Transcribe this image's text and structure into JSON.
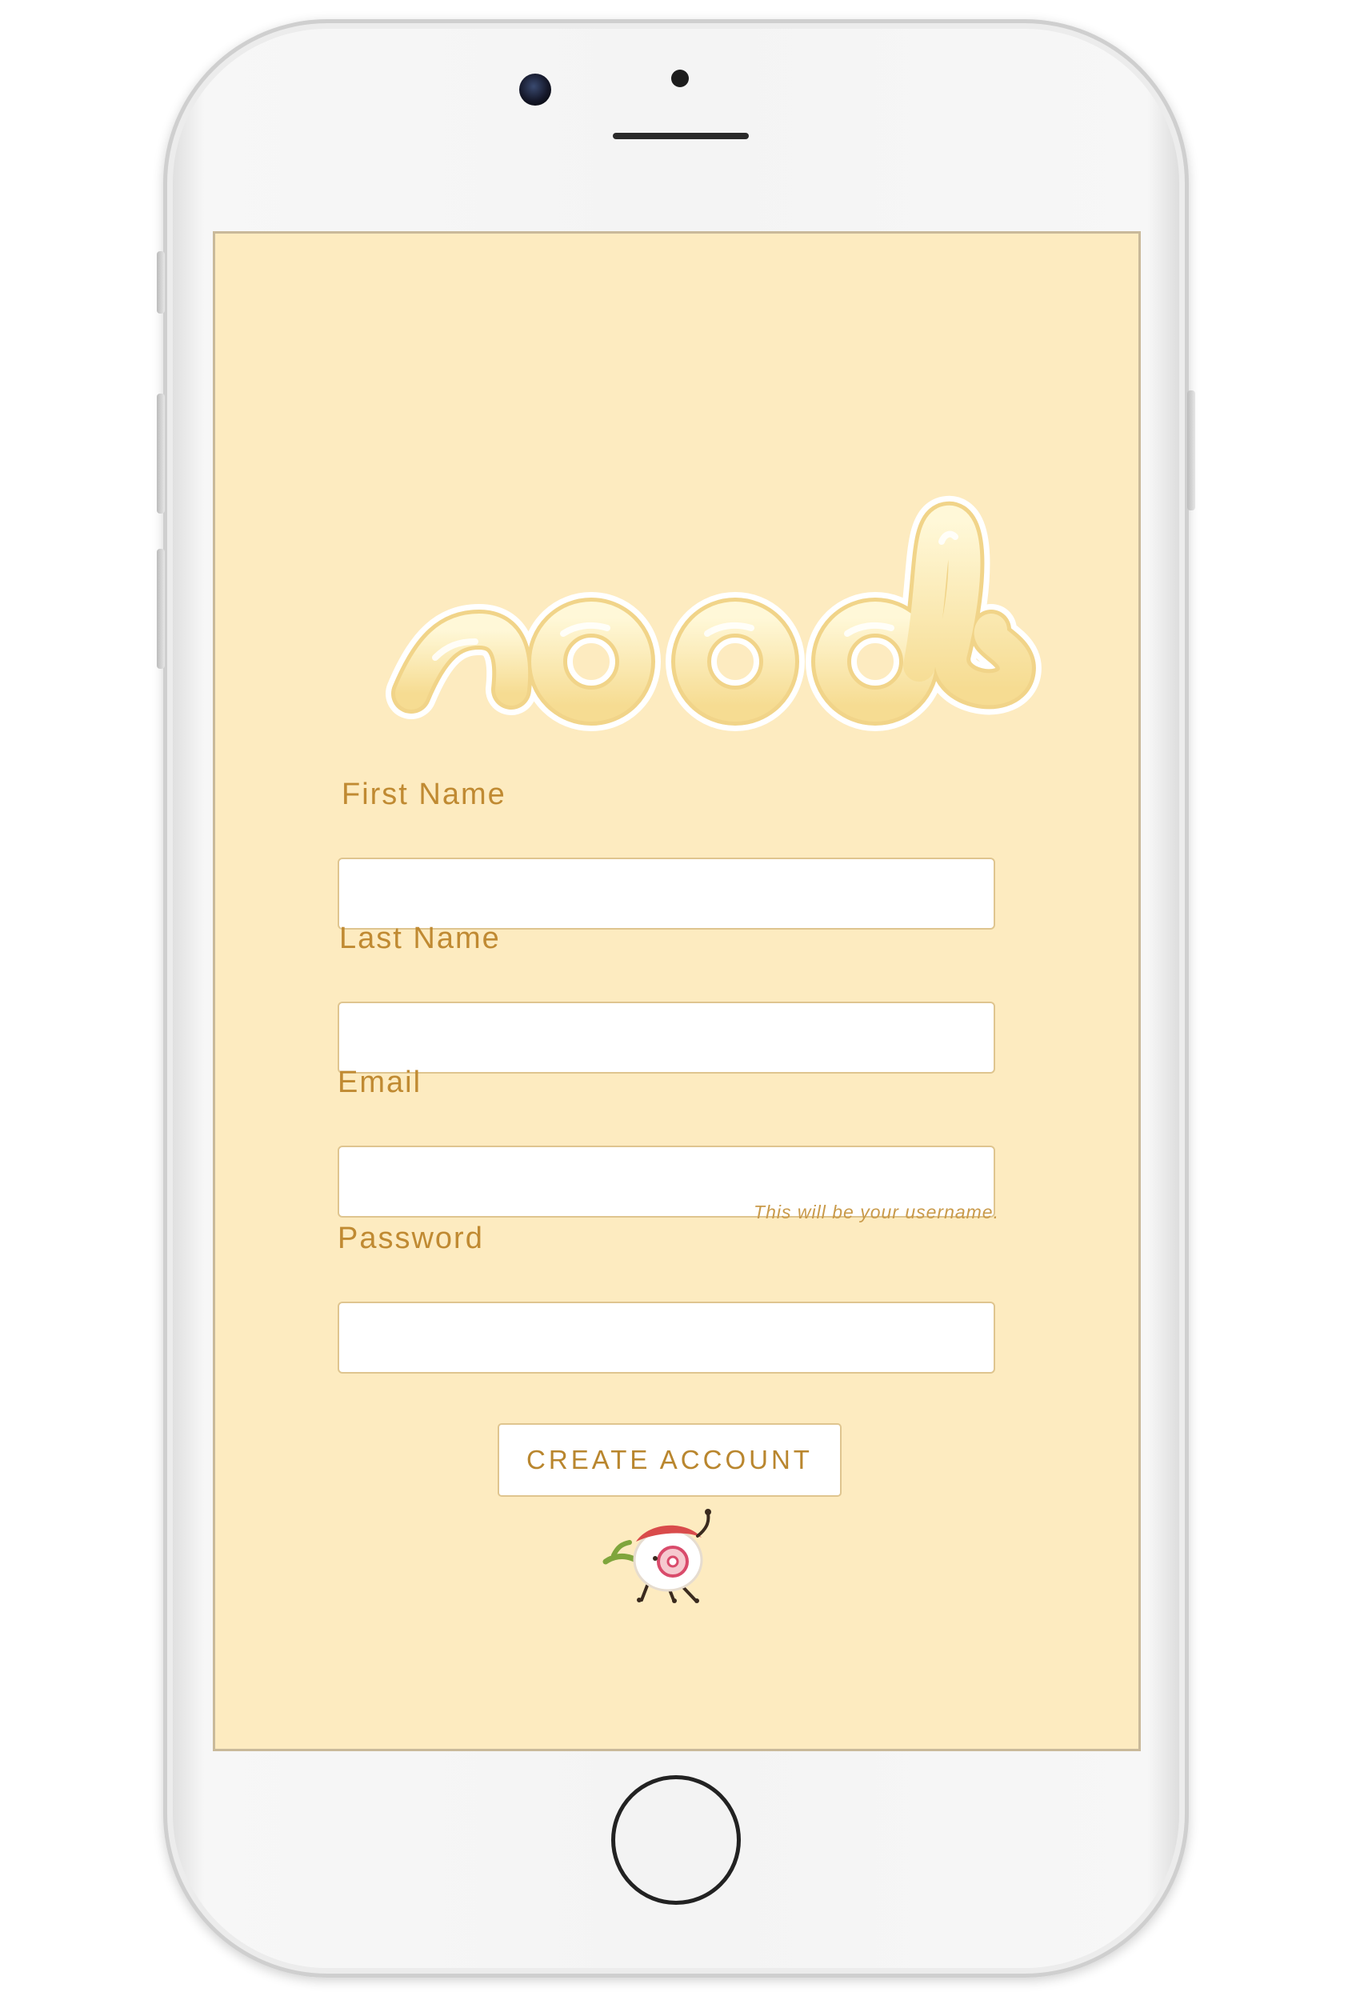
{
  "app": {
    "logo_text": "noods"
  },
  "form": {
    "first_name": {
      "label": "First Name",
      "value": ""
    },
    "last_name": {
      "label": "Last Name",
      "value": ""
    },
    "email": {
      "label": "Email",
      "value": "",
      "hint": "This will be your username."
    },
    "password": {
      "label": "Password",
      "value": ""
    },
    "submit_label": "CREATE ACCOUNT"
  },
  "colors": {
    "background": "#fdebc0",
    "accent": "#c08a32",
    "field_border": "#dfc58f"
  },
  "icons": [
    "noods-logo",
    "mascot-icon",
    "camera-icon",
    "home-button"
  ]
}
